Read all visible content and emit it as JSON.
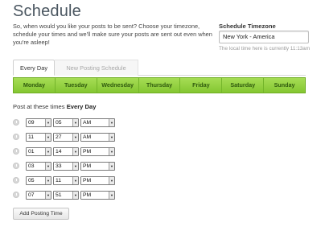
{
  "page": {
    "title": "Schedule",
    "intro": "So, when would you like your posts to be sent? Choose your timezone, schedule your times and we'll make sure your posts are sent out even when you're asleep!"
  },
  "timezone": {
    "label": "Schedule Timezone",
    "value": "New York - America",
    "note": "The local time here is currently 11:13am"
  },
  "tabs": [
    {
      "label": "Every Day",
      "active": true
    },
    {
      "label": "New Posting Schedule",
      "active": false
    }
  ],
  "days": [
    "Monday",
    "Tuesday",
    "Wednesday",
    "Thursday",
    "Friday",
    "Saturday",
    "Sunday"
  ],
  "posting": {
    "prefix": "Post at these times",
    "day": "Every Day"
  },
  "times": [
    {
      "hour": "09",
      "minute": "05",
      "period": "AM"
    },
    {
      "hour": "11",
      "minute": "27",
      "period": "AM"
    },
    {
      "hour": "01",
      "minute": "14",
      "period": "PM"
    },
    {
      "hour": "03",
      "minute": "33",
      "period": "PM"
    },
    {
      "hour": "05",
      "minute": "11",
      "period": "PM"
    },
    {
      "hour": "07",
      "minute": "51",
      "period": "PM"
    }
  ],
  "add_button": "Add Posting Time",
  "colors": {
    "day_bar": "#8ccc3a",
    "day_text": "#2f5a0e"
  }
}
